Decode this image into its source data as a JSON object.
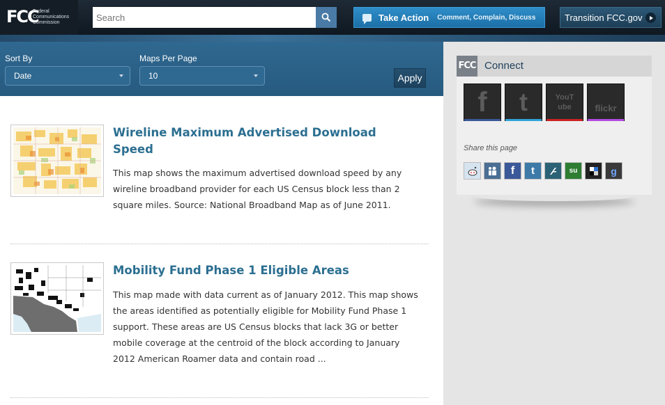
{
  "header": {
    "logo_mark": "FCC",
    "logo_text": [
      "Federal",
      "Communications",
      "Commission"
    ],
    "search": {
      "placeholder": "Search"
    },
    "take_action": {
      "title": "Take Action",
      "subtitle": "Comment, Complain, Discuss"
    },
    "transition_label": "Transition FCC.gov"
  },
  "filters": {
    "sort_by": {
      "label": "Sort By",
      "value": "Date"
    },
    "maps_per_page": {
      "label": "Maps Per Page",
      "value": "10"
    },
    "apply_label": "Apply"
  },
  "maps": [
    {
      "title": "Wireline Maximum Advertised Download Speed",
      "description": "This map shows the maximum advertised download speed by any wireline broadband provider for each US Census block less than 2 square miles. Source: National Broadband Map as of June 2011."
    },
    {
      "title": "Mobility Fund Phase 1 Eligible Areas",
      "description": "This map made with data current as of January 2012. This map shows the areas identified as potentially eligible for Mobility Fund Phase 1 support. These areas are US Census blocks that lack 3G or better mobile coverage at the centroid of the block according to January 2012 American Roamer data and contain road ..."
    }
  ],
  "sidebar": {
    "connect_logo": "FCC",
    "connect_title": "Connect",
    "social": [
      {
        "name": "facebook",
        "glyph": "f",
        "accent": "#3b5998"
      },
      {
        "name": "twitter",
        "glyph": "t",
        "accent": "#2fa4d8"
      },
      {
        "name": "youtube",
        "glyph": "YouTube",
        "accent": "#cc2222"
      },
      {
        "name": "flickr",
        "glyph": "flickr",
        "accent": "#b44be0"
      }
    ],
    "share_label": "Share this page",
    "share_icons": [
      "reddit",
      "myspace",
      "facebook",
      "twitter",
      "fark",
      "stumbleupon",
      "delicious",
      "google"
    ]
  },
  "colors": {
    "header_bg": "#141d26",
    "filter_bg": "#2f6890",
    "title_link": "#2c6f91",
    "take_action": "#2589c6"
  }
}
